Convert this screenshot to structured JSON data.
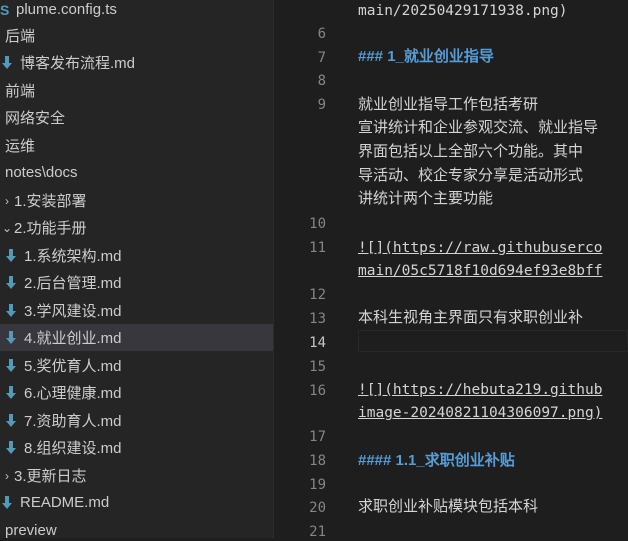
{
  "explorer": {
    "items": [
      {
        "label": "plume.config.ts",
        "icon": "ts-file-icon",
        "glyph": "S"
      },
      {
        "label": "后端"
      },
      {
        "label": "博客发布流程.md",
        "icon": "markdown-download-icon"
      },
      {
        "label": "前端"
      },
      {
        "label": "网络安全"
      },
      {
        "label": "运维"
      },
      {
        "label": "notes\\docs"
      },
      {
        "label": "1.安装部署",
        "arrow": "›"
      },
      {
        "label": "2.功能手册",
        "arrow": "⌄"
      },
      {
        "label": "1.系统架构.md",
        "icon": "markdown-download-icon"
      },
      {
        "label": "2.后台管理.md",
        "icon": "markdown-download-icon"
      },
      {
        "label": "3.学风建设.md",
        "icon": "markdown-download-icon"
      },
      {
        "label": "4.就业创业.md",
        "icon": "markdown-download-icon"
      },
      {
        "label": "5.奖优育人.md",
        "icon": "markdown-download-icon"
      },
      {
        "label": "6.心理健康.md",
        "icon": "markdown-download-icon"
      },
      {
        "label": "7.资助育人.md",
        "icon": "markdown-download-icon"
      },
      {
        "label": "8.组织建设.md",
        "icon": "markdown-download-icon"
      },
      {
        "label": "3.更新日志",
        "arrow": "›"
      },
      {
        "label": "README.md",
        "icon": "markdown-download-icon"
      },
      {
        "label": "preview"
      }
    ],
    "selected_index": 12
  },
  "editor": {
    "line_numbers": [
      "6",
      "7",
      "8",
      "9",
      "10",
      "11",
      "12",
      "13",
      "14",
      "15",
      "16",
      "17",
      "18",
      "19",
      "20",
      "21"
    ],
    "active_line": "14",
    "lines": [
      {
        "text": "main/20250429171938.png)"
      },
      {
        "text": "### 1_就业创业指导"
      },
      {
        "text": "        就业创业指导工作包括考研"
      },
      {
        "text": "宣讲统计和企业参观交流、就业指导"
      },
      {
        "text": "界面包括以上全部六个功能。其中"
      },
      {
        "text": "导活动、校企专家分享是活动形式"
      },
      {
        "text": "讲统计两个主要功能"
      },
      {
        "text": "![](https://raw.githubuserco"
      },
      {
        "text": "main/05c5718f10d694ef93e8bff"
      },
      {
        "text": "本科生视角主界面只有求职创业补"
      },
      {
        "text": "![](https://hebuta219.github"
      },
      {
        "text": "image-20240821104306097.png)"
      },
      {
        "text": "#### 1.1_求职创业补贴"
      },
      {
        "text": "        求职创业补贴模块包括本科"
      }
    ]
  },
  "colors": {
    "sidebar_bg": "#252526",
    "editor_bg": "#1e1e1e",
    "heading": "#569cd6",
    "md_icon": "#519aba",
    "selected_row": "#37373d"
  }
}
